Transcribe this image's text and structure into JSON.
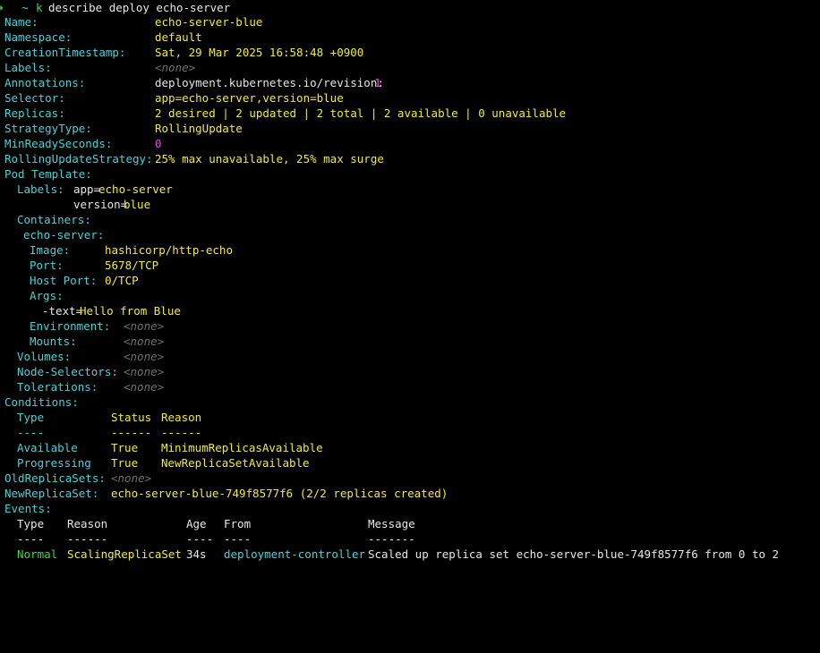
{
  "prompt": {
    "arrow": "➜",
    "cwd": "~",
    "cmd_k": "k",
    "cmd_rest": "describe deploy echo-server"
  },
  "fields": {
    "name": {
      "key": "Name:",
      "value": "echo-server-blue"
    },
    "namespace": {
      "key": "Namespace:",
      "value": "default"
    },
    "creation": {
      "key": "CreationTimestamp:",
      "value": "Sat, 29 Mar 2025 16:58:48 +0900"
    },
    "labels": {
      "key": "Labels:",
      "value": "<none>"
    },
    "annotations": {
      "key": "Annotations:",
      "value": "deployment.kubernetes.io/revision: ",
      "num": "1"
    },
    "selector": {
      "key": "Selector:",
      "value": "app=echo-server,version=blue"
    },
    "replicas": {
      "key": "Replicas:",
      "value": "2 desired | 2 updated | 2 total | 2 available | 0 unavailable"
    },
    "strategy": {
      "key": "StrategyType:",
      "value": "RollingUpdate"
    },
    "minready": {
      "key": "MinReadySeconds:",
      "value": "0"
    },
    "rolling": {
      "key": "RollingUpdateStrategy:",
      "value": "25% max unavailable, 25% max surge"
    }
  },
  "pod_template": {
    "header": "Pod Template:",
    "labels_key": "Labels:",
    "label1_key": "app=",
    "label1_val": "echo-server",
    "label2_key": "version=",
    "label2_val": "blue",
    "containers_key": "Containers:",
    "container_name": "echo-server:",
    "image_key": "Image:",
    "image_val": "hashicorp/http-echo",
    "port_key": "Port:",
    "port_val": "5678/TCP",
    "hostport_key": "Host Port:",
    "hostport_val": "0/TCP",
    "args_key": "Args:",
    "arg_flag": "-text=",
    "arg_val": "Hello from Blue",
    "env_key": "Environment:",
    "env_val": "<none>",
    "mounts_key": "Mounts:",
    "mounts_val": "<none>",
    "volumes_key": "Volumes:",
    "volumes_val": "<none>",
    "nodesel_key": "Node-Selectors:",
    "nodesel_val": "<none>",
    "tol_key": "Tolerations:",
    "tol_val": "<none>"
  },
  "conditions": {
    "header": "Conditions:",
    "col_type": "Type",
    "col_status": "Status",
    "col_reason": "Reason",
    "sep_type": "----",
    "sep_status": "------",
    "sep_reason": "------",
    "rows": [
      {
        "type": "Available",
        "status": "True",
        "reason": "MinimumReplicasAvailable"
      },
      {
        "type": "Progressing",
        "status": "True",
        "reason": "NewReplicaSetAvailable"
      }
    ]
  },
  "replicasets": {
    "old_key": "OldReplicaSets:",
    "old_val": "<none>",
    "new_key": "NewReplicaSet:",
    "new_val": "echo-server-blue-749f8577f6 (2/2 replicas created)"
  },
  "events": {
    "header": "Events:",
    "col_type": "Type",
    "col_reason": "Reason",
    "col_age": "Age",
    "col_from": "From",
    "col_message": "Message",
    "sep_type": "----",
    "sep_reason": "------",
    "sep_age": "----",
    "sep_from": "----",
    "sep_message": "-------",
    "rows": [
      {
        "type": "Normal",
        "reason": "ScalingReplicaSet",
        "age": "34s",
        "from": "deployment-controller",
        "message": "Scaled up replica set echo-server-blue-749f8577f6 from 0 to 2"
      }
    ]
  },
  "colors": {
    "background": "#000000",
    "key": "#4cd0d8",
    "value": "#f2ea3a",
    "number": "#d651d8",
    "none": "#6f6f6f",
    "prompt": "#4bd14b"
  }
}
